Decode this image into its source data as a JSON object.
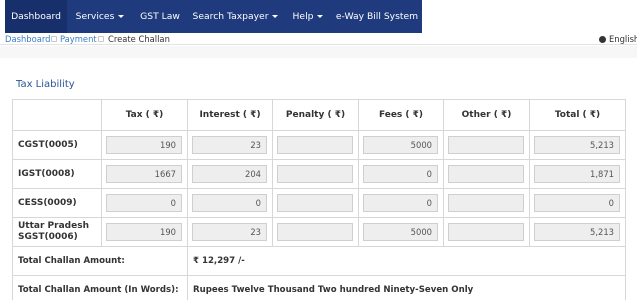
{
  "nav": {
    "items": [
      {
        "label": "Dashboard",
        "has_caret": false
      },
      {
        "label": "Services",
        "has_caret": true
      },
      {
        "label": "GST Law",
        "has_caret": false
      },
      {
        "label": "Search Taxpayer",
        "has_caret": true
      },
      {
        "label": "Help",
        "has_caret": true
      },
      {
        "label": "e-Way Bill System",
        "has_caret": false
      }
    ]
  },
  "breadcrumb": {
    "dashboard": "Dashboard",
    "payment": "Payment",
    "current": "Create Challan"
  },
  "language": "English",
  "section_title": "Tax Liability",
  "table": {
    "headers": [
      "",
      "Tax ( ₹)",
      "Interest ( ₹)",
      "Penalty ( ₹)",
      "Fees ( ₹)",
      "Other ( ₹)",
      "Total ( ₹)"
    ],
    "rows": [
      {
        "label": "CGST(0005)",
        "tax": "190",
        "interest": "23",
        "penalty": "",
        "fees": "5000",
        "other": "",
        "total": "5,213"
      },
      {
        "label": "IGST(0008)",
        "tax": "1667",
        "interest": "204",
        "penalty": "",
        "fees": "0",
        "other": "",
        "total": "1,871"
      },
      {
        "label": "CESS(0009)",
        "tax": "0",
        "interest": "0",
        "penalty": "",
        "fees": "0",
        "other": "",
        "total": "0"
      },
      {
        "label": "Uttar Pradesh SGST(0006)",
        "tax": "190",
        "interest": "23",
        "penalty": "",
        "fees": "5000",
        "other": "",
        "total": "5,213"
      }
    ],
    "total_amount_label": "Total Challan Amount:",
    "total_amount_value": "₹ 12,297 /-",
    "total_words_label": "Total Challan Amount (In Words):",
    "total_words_value": "Rupees Twelve Thousand Two hundred Ninety-Seven Only"
  },
  "colors": {
    "nav_bg": "#1f3a7d",
    "link": "#3c7ec2",
    "section_title": "#2a5597"
  }
}
